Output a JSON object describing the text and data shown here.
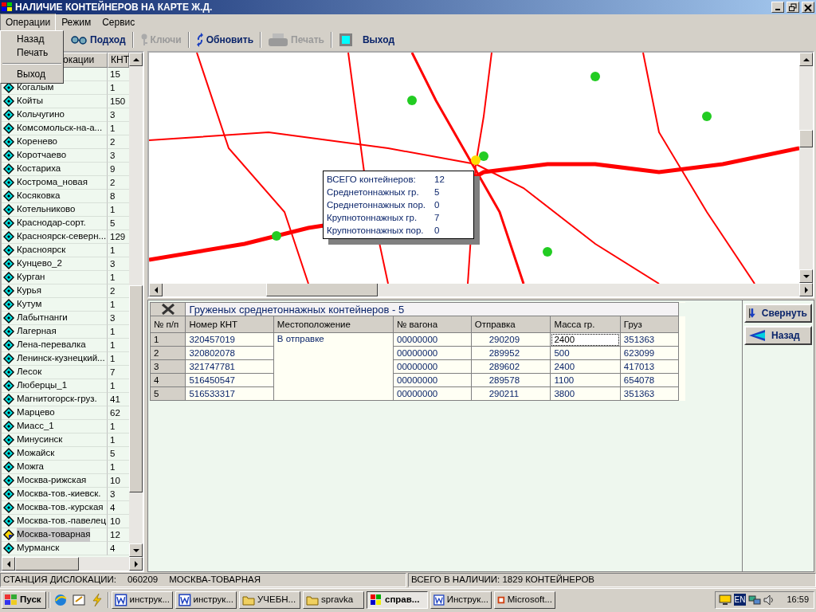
{
  "window": {
    "title": "НАЛИЧИЕ КОНТЕЙНЕРОВ НА КАРТЕ Ж.Д."
  },
  "menu": [
    {
      "label": "Операции",
      "selected": true
    },
    {
      "label": "Режим",
      "selected": false
    },
    {
      "label": "Сервис",
      "selected": false
    }
  ],
  "dropdown": [
    {
      "kind": "item",
      "label": "Назад"
    },
    {
      "kind": "item",
      "label": "Печать"
    },
    {
      "kind": "separator"
    },
    {
      "kind": "item",
      "label": "Выход"
    }
  ],
  "toolbar": [
    {
      "label": "Подход",
      "disabled": false
    },
    {
      "label": "Ключи",
      "disabled": true
    },
    {
      "label": "Обновить",
      "disabled": false
    },
    {
      "label": "Печать",
      "disabled": true
    },
    {
      "label": "Выход",
      "disabled": false
    }
  ],
  "station_list": {
    "columns": [
      "окации",
      "КНТ"
    ],
    "rows": [
      {
        "count": "15",
        "selected": false
      },
      {
        "name": "Когалым",
        "count": "1",
        "selected": false
      },
      {
        "name": "Койты",
        "count": "150",
        "selected": false
      },
      {
        "name": "Кольчугино",
        "count": "3",
        "selected": false
      },
      {
        "name": "Комсомольск-на-а...",
        "count": "1",
        "selected": false
      },
      {
        "name": "Коренево",
        "count": "2",
        "selected": false
      },
      {
        "name": "Коротчаево",
        "count": "3",
        "selected": false
      },
      {
        "name": "Костариха",
        "count": "9",
        "selected": false
      },
      {
        "name": "Кострома_новая",
        "count": "2",
        "selected": false
      },
      {
        "name": "Косяковка",
        "count": "8",
        "selected": false
      },
      {
        "name": "Котельниково",
        "count": "1",
        "selected": false
      },
      {
        "name": "Краснодар-сорт.",
        "count": "5",
        "selected": false
      },
      {
        "name": "Красноярск-северн...",
        "count": "129",
        "selected": false
      },
      {
        "name": "Красноярск",
        "count": "1",
        "selected": false
      },
      {
        "name": "Кунцево_2",
        "count": "3",
        "selected": false
      },
      {
        "name": "Курган",
        "count": "1",
        "selected": false
      },
      {
        "name": "Курья",
        "count": "2",
        "selected": false
      },
      {
        "name": "Кутум",
        "count": "1",
        "selected": false
      },
      {
        "name": "Лабытнанги",
        "count": "3",
        "selected": false
      },
      {
        "name": "Лагерная",
        "count": "1",
        "selected": false
      },
      {
        "name": "Лена-перевалка",
        "count": "1",
        "selected": false
      },
      {
        "name": "Ленинск-кузнецкий...",
        "count": "1",
        "selected": false
      },
      {
        "name": "Лесок",
        "count": "7",
        "selected": false
      },
      {
        "name": "Люберцы_1",
        "count": "1",
        "selected": false
      },
      {
        "name": "Магнитогорск-груз.",
        "count": "41",
        "selected": false
      },
      {
        "name": "Марцево",
        "count": "62",
        "selected": false
      },
      {
        "name": "Миасс_1",
        "count": "1",
        "selected": false
      },
      {
        "name": "Минусинск",
        "count": "1",
        "selected": false
      },
      {
        "name": "Можайск",
        "count": "5",
        "selected": false
      },
      {
        "name": "Можга",
        "count": "1",
        "selected": false
      },
      {
        "name": "Москва-рижская",
        "count": "10",
        "selected": false
      },
      {
        "name": "Москва-тов.-киевск.",
        "count": "3",
        "selected": false
      },
      {
        "name": "Москва-тов.-курская",
        "count": "4",
        "selected": false
      },
      {
        "name": "Москва-тов.-павелец",
        "count": "10",
        "selected": false
      },
      {
        "name": "Москва-товарная",
        "count": "12",
        "selected": true
      },
      {
        "name": "Мурманск",
        "count": "4",
        "selected": false
      }
    ]
  },
  "map": {
    "kind": "picture",
    "tooltip": [
      {
        "label": "ВСЕГО контейнеров:",
        "value": "12"
      },
      {
        "label": "Среднетоннажных гр.",
        "value": "5"
      },
      {
        "label": "Среднетоннажных пор.",
        "value": "0"
      },
      {
        "label": "Крупнотоннажных гр.",
        "value": "7"
      },
      {
        "label": "Крупнотоннажных пор.",
        "value": "0"
      }
    ]
  },
  "table": {
    "title": "Груженых среднетоннажных контейнеров - 5",
    "columns": [
      "№ п/п",
      "Номер КНТ",
      "Местоположение",
      "№ вагона",
      "Отправка",
      "Масса гр.",
      "Груз"
    ],
    "location": "В отправке",
    "rows": [
      {
        "n": "1",
        "number": "320457019",
        "wagon": "00000000",
        "dispatch": "290209",
        "mass": "2400",
        "cargo": "351363",
        "focused": true
      },
      {
        "n": "2",
        "number": "320802078",
        "wagon": "00000000",
        "dispatch": "289952",
        "mass": "500",
        "cargo": "623099",
        "focused": false
      },
      {
        "n": "3",
        "number": "321747781",
        "wagon": "00000000",
        "dispatch": "289602",
        "mass": "2400",
        "cargo": "417013",
        "focused": false
      },
      {
        "n": "4",
        "number": "516450547",
        "wagon": "00000000",
        "dispatch": "289578",
        "mass": "1100",
        "cargo": "654078",
        "focused": false
      },
      {
        "n": "5",
        "number": "516533317",
        "wagon": "00000000",
        "dispatch": "290211",
        "mass": "3800",
        "cargo": "351363",
        "focused": false
      }
    ]
  },
  "side_buttons": [
    {
      "label": "Свернуть"
    },
    {
      "label": "Назад"
    }
  ],
  "status_bar": [
    [
      "СТАНЦИЯ ДИСЛОКАЦИИ:",
      "060209",
      "МОСКВА-ТОВАРНАЯ"
    ],
    [
      "ВСЕГО В НАЛИЧИИ: 1829 КОНТЕЙНЕРОВ"
    ]
  ],
  "taskbar": {
    "start": "Пуск",
    "tasks": [
      {
        "kind": "document",
        "label": "инструк...",
        "selected": false
      },
      {
        "kind": "document",
        "label": "инструк...",
        "selected": false
      },
      {
        "kind": "folder",
        "label": "УЧЕБН...",
        "selected": false
      },
      {
        "kind": "folder",
        "label": "spravka",
        "selected": false
      },
      {
        "kind": "app",
        "label": "справ...",
        "selected": true
      },
      {
        "kind": "document",
        "label": "Инструк...",
        "selected": false
      },
      {
        "kind": "presentation",
        "label": "Microsoft...",
        "selected": false
      }
    ],
    "language": "EN",
    "time": "16:59"
  }
}
